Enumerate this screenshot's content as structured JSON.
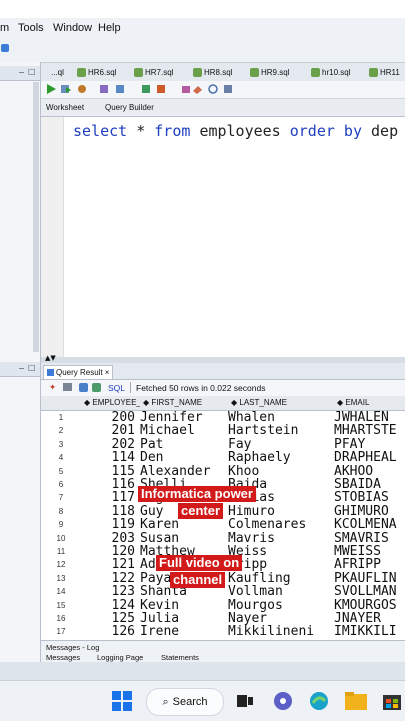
{
  "menu": {
    "items": [
      "m",
      "Tools",
      "Window",
      "Help"
    ]
  },
  "file_tabs": [
    "...ql",
    "HR6.sql",
    "HR7.sql",
    "HR8.sql",
    "HR9.sql",
    "hr10.sql",
    "HR11"
  ],
  "sub_tabs": {
    "worksheet": "Worksheet",
    "query_builder": "Query Builder"
  },
  "editor": {
    "kw1": "select",
    "star": "*",
    "kw2": "from",
    "table": "employees",
    "kw3": "order by",
    "rest": "dep"
  },
  "results": {
    "tab_label": "Query Result",
    "sql_label": "SQL",
    "status": "Fetched 50 rows in 0.022 seconds",
    "columns": [
      "EMPLOYEE_ID",
      "FIRST_NAME",
      "LAST_NAME",
      "EMAIL"
    ],
    "rows": [
      [
        "1",
        "200",
        "Jennifer",
        "Whalen",
        "JWHALEN"
      ],
      [
        "2",
        "201",
        "Michael",
        "Hartstein",
        "MHARTSTE"
      ],
      [
        "3",
        "202",
        "Pat",
        "Fay",
        "PFAY"
      ],
      [
        "4",
        "114",
        "Den",
        "Raphaely",
        "DRAPHEAL"
      ],
      [
        "5",
        "115",
        "Alexander",
        "Khoo",
        "AKHOO"
      ],
      [
        "6",
        "116",
        "Shelli",
        "Baida",
        "SBAIDA"
      ],
      [
        "7",
        "117",
        "Sigal",
        "Tobias",
        "STOBIAS"
      ],
      [
        "8",
        "118",
        "Guy",
        "Himuro",
        "GHIMURO"
      ],
      [
        "9",
        "119",
        "Karen",
        "Colmenares",
        "KCOLMENA"
      ],
      [
        "10",
        "203",
        "Susan",
        "Mavris",
        "SMAVRIS"
      ],
      [
        "11",
        "120",
        "Matthew",
        "Weiss",
        "MWEISS"
      ],
      [
        "12",
        "121",
        "Adam",
        "Fripp",
        "AFRIPP"
      ],
      [
        "13",
        "122",
        "Payam",
        "Kaufling",
        "PKAUFLIN"
      ],
      [
        "14",
        "123",
        "Shanta",
        "Vollman",
        "SVOLLMAN"
      ],
      [
        "15",
        "124",
        "Kevin",
        "Mourgos",
        "KMOURGOS"
      ],
      [
        "16",
        "125",
        "Julia",
        "Nayer",
        "JNAYER"
      ],
      [
        "17",
        "126",
        "Irene",
        "Mikkilineni",
        "IMIKKILI"
      ]
    ]
  },
  "overlays": {
    "line1": "Informatica power",
    "line2": "center",
    "line3": "Full video on",
    "line4": "channel"
  },
  "messages": {
    "title": "Messages - Log",
    "tabs": [
      "Messages",
      "Logging Page",
      "Statements"
    ]
  },
  "taskbar": {
    "search_label": "Search"
  },
  "colors": {
    "keyword": "#1f3fbf",
    "overlay": "#d31a1a",
    "run_green": "#2c9a2c"
  }
}
